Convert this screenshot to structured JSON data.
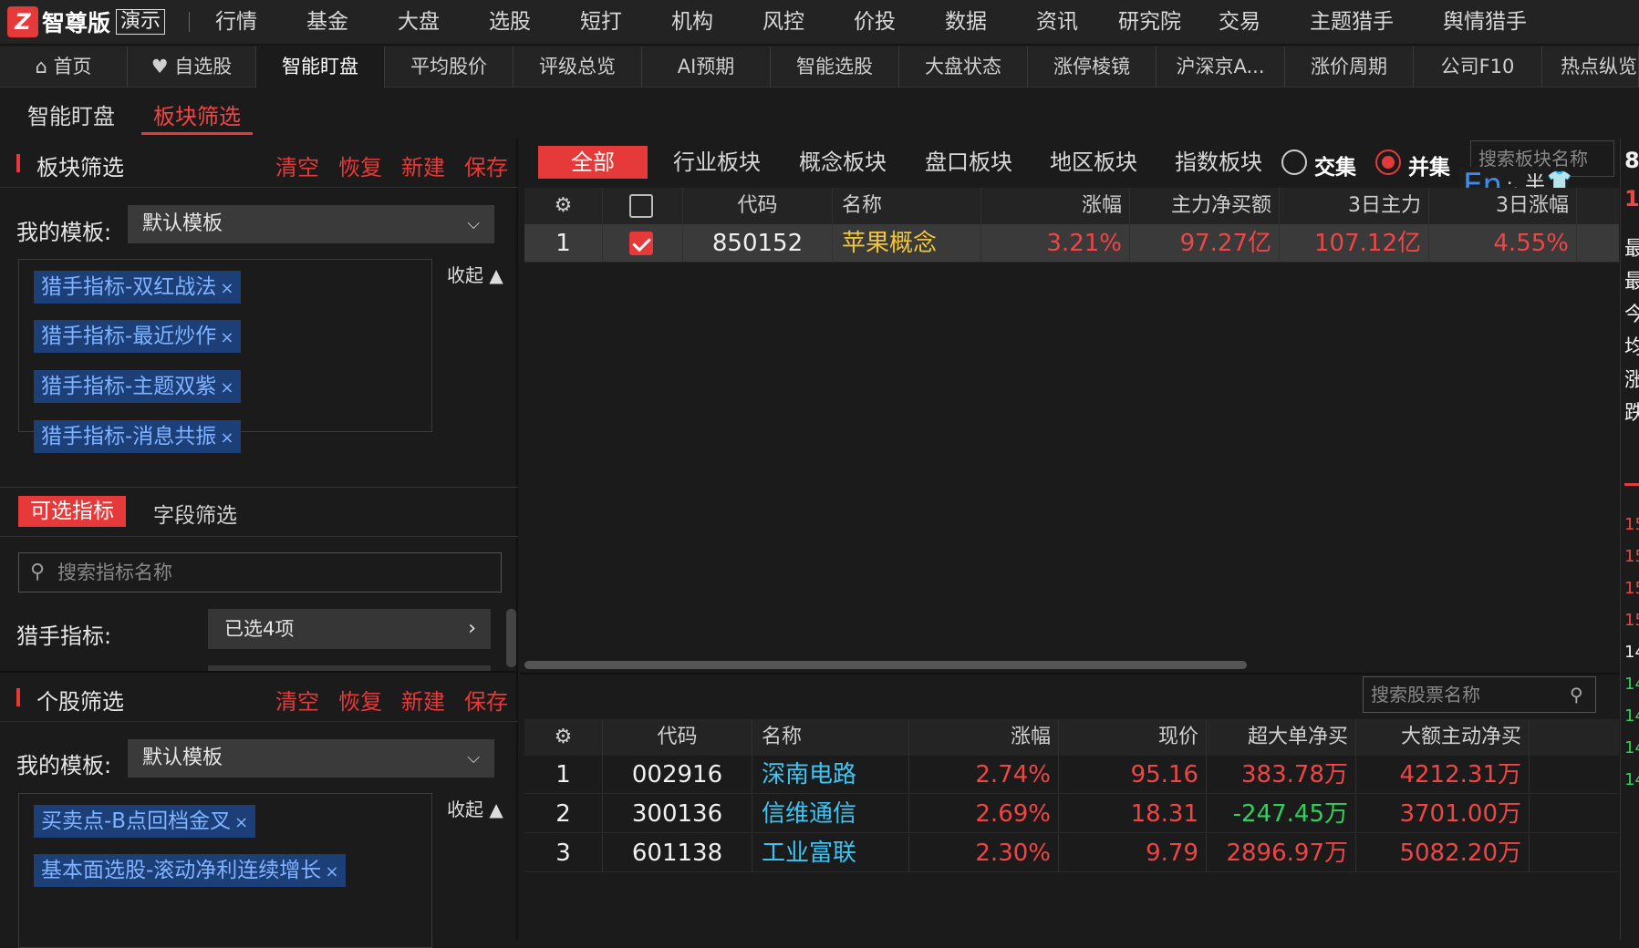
{
  "app": {
    "logo_char": "Z",
    "name": "智尊版",
    "demo_badge": "演示"
  },
  "menu": [
    "行情",
    "基金",
    "大盘",
    "选股",
    "短打",
    "机构",
    "风控",
    "价投",
    "数据",
    "资讯",
    "研究院",
    "交易",
    "主题猎手",
    "舆情猎手"
  ],
  "tabs": [
    "首页",
    "自选股",
    "智能盯盘",
    "平均股价",
    "评级总览",
    "AI预期",
    "智能选股",
    "大盘状态",
    "涨停棱镜",
    "沪深京A...",
    "涨价周期",
    "公司F10",
    "热点纵览"
  ],
  "subtabs": [
    "智能盯盘",
    "板块筛选"
  ],
  "sector_filter": {
    "title": "板块筛选",
    "actions": [
      "清空",
      "恢复",
      "新建",
      "保存"
    ],
    "template_label": "我的模板:",
    "template_value": "默认模板",
    "collapse": "收起",
    "tags": [
      "猎手指标-双红战法",
      "猎手指标-最近炒作",
      "猎手指标-主题双紫",
      "猎手指标-消息共振"
    ],
    "indicator_tabs": [
      "可选指标",
      "字段筛选"
    ],
    "search_placeholder": "搜索指标名称",
    "hunter_label": "猎手指标:",
    "hunter_value": "已选4项"
  },
  "stock_filter": {
    "title": "个股筛选",
    "actions": [
      "清空",
      "恢复",
      "新建",
      "保存"
    ],
    "template_label": "我的模板:",
    "template_value": "默认模板",
    "collapse": "收起",
    "tags": [
      "买卖点-B点回档金叉",
      "基本面选股-滚动净利连续增长"
    ]
  },
  "sector_table": {
    "categories": [
      "全部",
      "行业板块",
      "概念板块",
      "盘口板块",
      "地区板块",
      "指数板块"
    ],
    "radio_intersect": "交集",
    "radio_union": "并集",
    "search_placeholder": "搜索板块名称",
    "headers": [
      "代码",
      "名称",
      "涨幅",
      "主力净买额",
      "3日主力",
      "3日涨幅"
    ],
    "rows": [
      {
        "idx": "1",
        "code": "850152",
        "name": "苹果概念",
        "chg": "3.21%",
        "net": "97.27亿",
        "main3": "107.12亿",
        "chg3": "4.55%"
      }
    ]
  },
  "ime": {
    "lang": "En",
    "punct": "·,",
    "width": "半"
  },
  "stock_table": {
    "search_placeholder": "搜索股票名称",
    "headers": [
      "代码",
      "名称",
      "涨幅",
      "现价",
      "超大单净买",
      "大额主动净买"
    ],
    "rows": [
      {
        "idx": "1",
        "code": "002916",
        "name": "深南电路",
        "chg": "2.74%",
        "price": "95.16",
        "super": "383.78万",
        "big": "4212.31万"
      },
      {
        "idx": "2",
        "code": "300136",
        "name": "信维通信",
        "chg": "2.69%",
        "price": "18.31",
        "super": "-247.45万",
        "big": "3701.00万"
      },
      {
        "idx": "3",
        "code": "601138",
        "name": "工业富联",
        "chg": "2.30%",
        "price": "9.79",
        "super": "2896.97万",
        "big": "5082.20万"
      }
    ]
  },
  "right_strip": {
    "top": [
      "8",
      "1"
    ],
    "labels": [
      "最",
      "最",
      "今",
      "均",
      "涨",
      "跌"
    ],
    "nums": [
      "15",
      "15",
      "15",
      "15",
      "14",
      "14",
      "14",
      "14",
      "14"
    ]
  }
}
